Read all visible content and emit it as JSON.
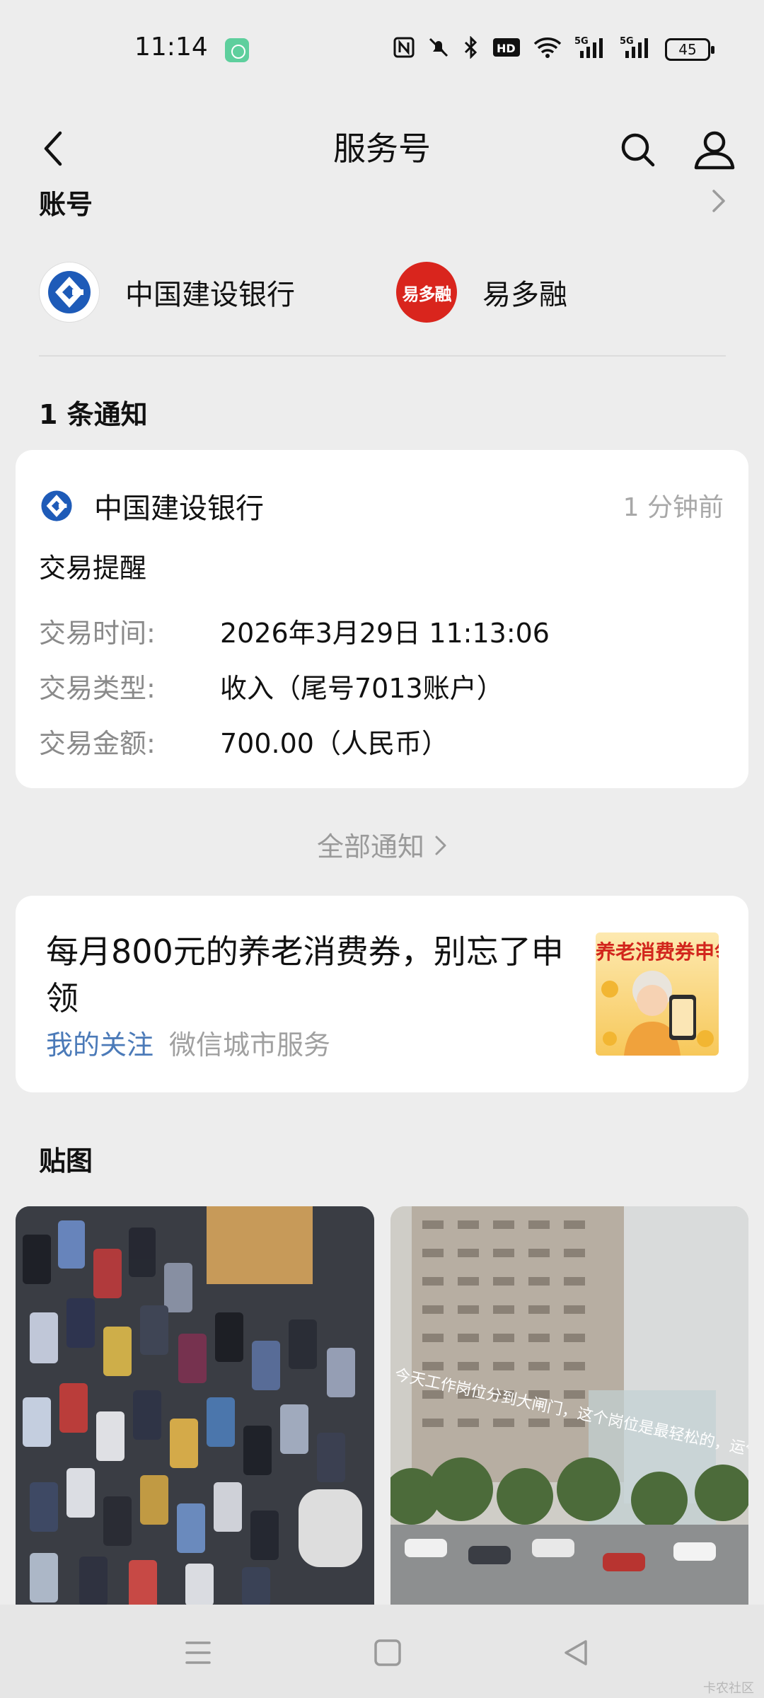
{
  "status_bar": {
    "time": "11:14",
    "battery": "45",
    "icons": [
      "nfc-icon",
      "mute-icon",
      "bluetooth-icon",
      "hd-icon",
      "wifi-icon",
      "5g-signal-icon",
      "5g-signal-icon"
    ]
  },
  "nav": {
    "title": "服务号"
  },
  "accounts": {
    "title": "账号",
    "items": [
      {
        "name": "中国建设银行"
      },
      {
        "name": "易多融",
        "logo_text": "易多融"
      }
    ]
  },
  "notices": {
    "title": "1 条通知",
    "card": {
      "bank": "中国建设银行",
      "time_ago": "1 分钟前",
      "subject": "交易提醒",
      "rows": [
        {
          "label": "交易时间:",
          "value": "2026年3月29日 11:13:06"
        },
        {
          "label": "交易类型:",
          "value": "收入（尾号7013账户）"
        },
        {
          "label": "交易金额:",
          "value": "700.00（人民币）"
        }
      ]
    },
    "all_label": "全部通知"
  },
  "promo": {
    "text": "每月800元的养老消费券，别忘了申领",
    "follow": "我的关注",
    "source": "微信城市服务",
    "thumb_text": "养老消费券申领"
  },
  "stickers": {
    "title": "贴图",
    "right_caption": "今天工作岗位分到大闸门，这个岗位是最轻松的，运气不错"
  },
  "watermark": "卡农社区",
  "colors": {
    "background": "#ededed",
    "card": "#ffffff",
    "accent_link": "#4b7ab8",
    "ccb_blue": "#1e5bb8",
    "ydr_red": "#d9251d"
  }
}
